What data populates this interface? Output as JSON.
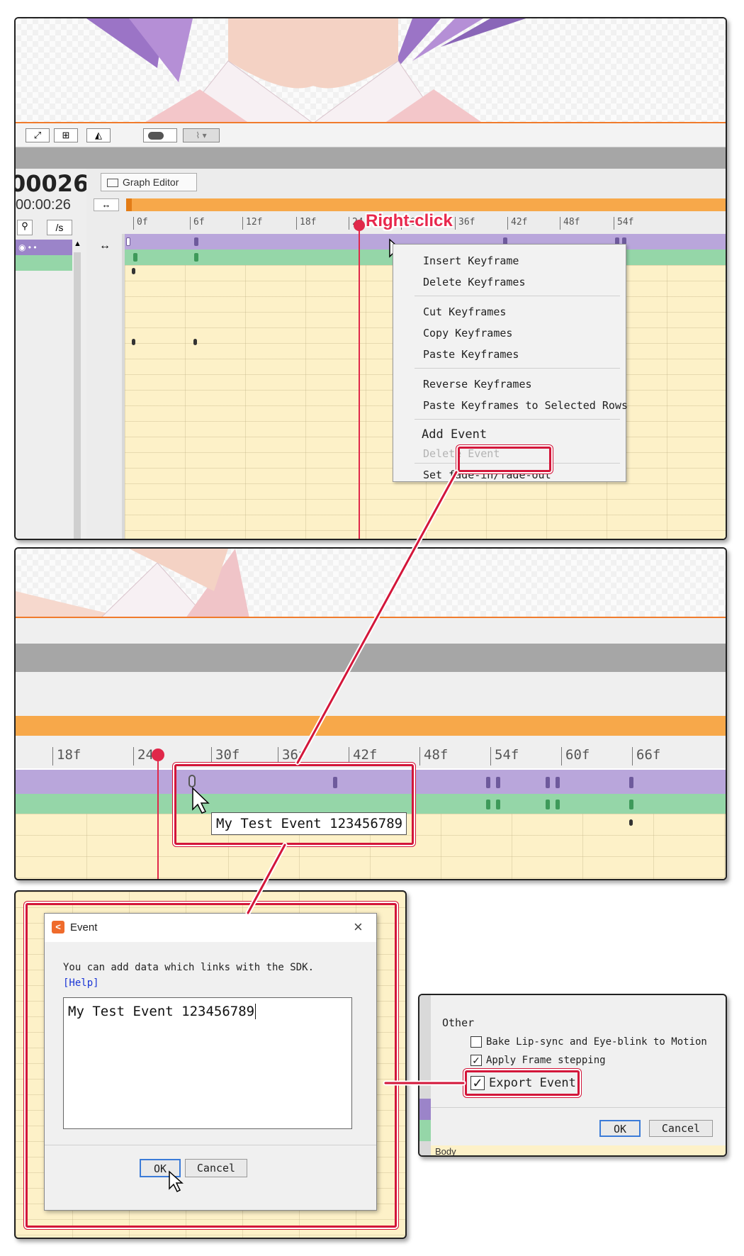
{
  "panel1": {
    "frame_number": "00026",
    "timecode": "00:00:26",
    "fps_label": "/s",
    "graph_editor_label": "Graph Editor",
    "ruler_ticks": [
      "0f",
      "6f",
      "12f",
      "18f",
      "24",
      "30f",
      "36f",
      "42f",
      "48f",
      "54f"
    ],
    "annotation": "Right-click",
    "context_menu": {
      "items": [
        "Insert Keyframe",
        "Delete Keyframes",
        "Cut Keyframes",
        "Copy Keyframes",
        "Paste Keyframes",
        "Reverse Keyframes",
        "Paste Keyframes to Selected Rows",
        "Add Event",
        "Delete Event",
        "Set fade-in/fade-out"
      ]
    }
  },
  "panel2": {
    "ruler_ticks": [
      "18f",
      "24",
      "30f",
      "36f",
      "42f",
      "48f",
      "54f",
      "60f",
      "66f"
    ],
    "tooltip": "My Test Event 123456789"
  },
  "event_dialog": {
    "title": "Event",
    "description": "You can add data which links with the SDK.",
    "help_link": "[Help]",
    "input_value": "My Test Event 123456789",
    "ok_label": "OK",
    "cancel_label": "Cancel"
  },
  "export_dialog": {
    "section_label": "Other",
    "options": [
      {
        "label": "Bake Lip-sync and Eye-blink to Motion",
        "checked": false
      },
      {
        "label": "Apply Frame stepping",
        "checked": true
      },
      {
        "label": "Export Event",
        "checked": true
      }
    ],
    "ok_label": "OK",
    "cancel_label": "Cancel",
    "bottom_label": "Body"
  },
  "colors": {
    "accent_red": "#d3163a",
    "timeline_orange": "#f7a84a",
    "purple_track": "#b9a6db",
    "green_track": "#95d6a8",
    "grid_yellow": "#fdf1c8"
  }
}
